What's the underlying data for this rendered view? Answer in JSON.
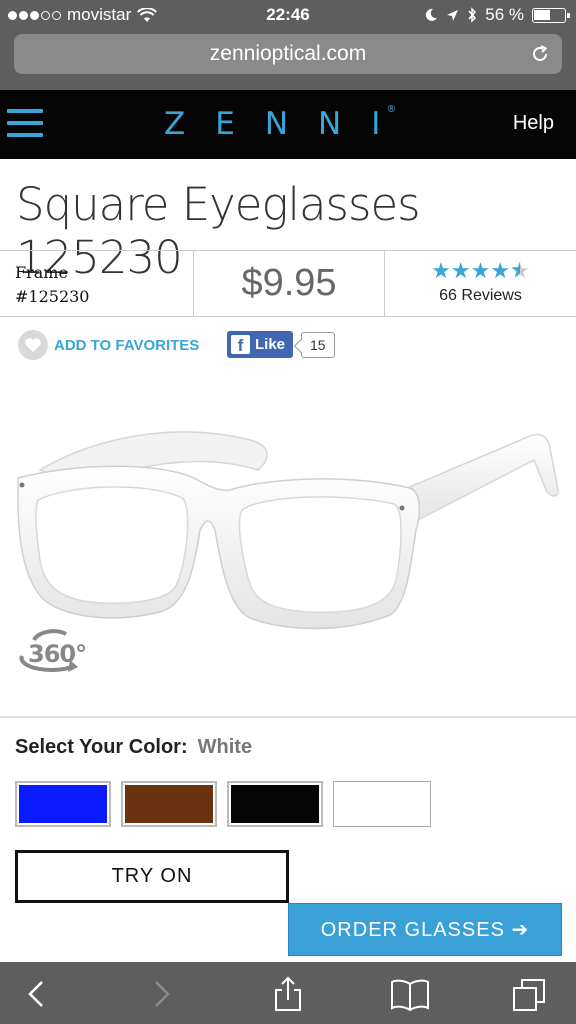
{
  "status_bar": {
    "carrier": "movistar",
    "time": "22:46",
    "battery_text": "56 %",
    "battery_level": 0.56
  },
  "browser": {
    "url": "zennioptical.com"
  },
  "header": {
    "logo": "ZENNI",
    "logo_mark": "®",
    "help_label": "Help"
  },
  "product": {
    "title": "Square Eyeglasses 125230",
    "frame_label": "Frame",
    "frame_number": "#125230",
    "price": "$9.95",
    "rating": 4.5,
    "reviews_text": "66 Reviews",
    "favorites_label": "ADD TO FAVORITES",
    "fb_like_label": "Like",
    "fb_like_count": "15",
    "view_360_label": "360°"
  },
  "color_select": {
    "label": "Select Your Color:",
    "selected": "White",
    "swatches": [
      {
        "name": "blue",
        "color": "#0a1cff"
      },
      {
        "name": "brown",
        "color": "#6b3310"
      },
      {
        "name": "black",
        "color": "#050505"
      },
      {
        "name": "white",
        "color": "#ffffff"
      }
    ]
  },
  "actions": {
    "try_on_label": "TRY ON",
    "order_label": "ORDER GLASSES ➔"
  },
  "colors": {
    "accent": "#3aa5d8",
    "header_bg": "#050505",
    "chrome_bg": "#5e5e5e"
  }
}
